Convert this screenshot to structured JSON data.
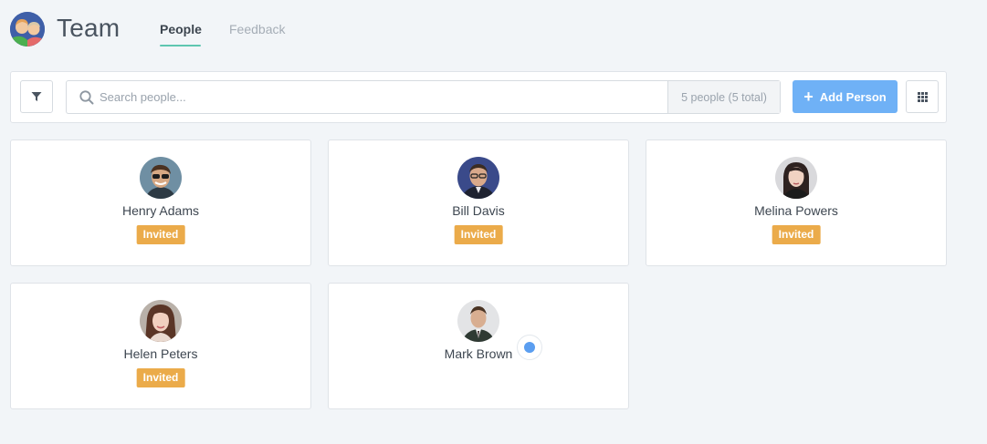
{
  "header": {
    "title": "Team",
    "tabs": [
      {
        "label": "People",
        "active": true
      },
      {
        "label": "Feedback",
        "active": false
      }
    ]
  },
  "toolbar": {
    "filter_icon": "filter-icon",
    "search_placeholder": "Search people...",
    "search_value": "",
    "count_text": "5 people (5 total)",
    "add_button_label": "Add Person",
    "view_toggle_icon": "grid-icon"
  },
  "people": [
    {
      "name": "Henry Adams",
      "status": "Invited"
    },
    {
      "name": "Bill Davis",
      "status": "Invited"
    },
    {
      "name": "Melina Powers",
      "status": "Invited"
    },
    {
      "name": "Helen Peters",
      "status": "Invited"
    },
    {
      "name": "Mark Brown",
      "status": ""
    }
  ],
  "colors": {
    "accent": "#6fb1f6",
    "tab_underline": "#5ec6b0",
    "invited_badge": "#ebab4a",
    "status_dot": "#5b9ef0"
  }
}
